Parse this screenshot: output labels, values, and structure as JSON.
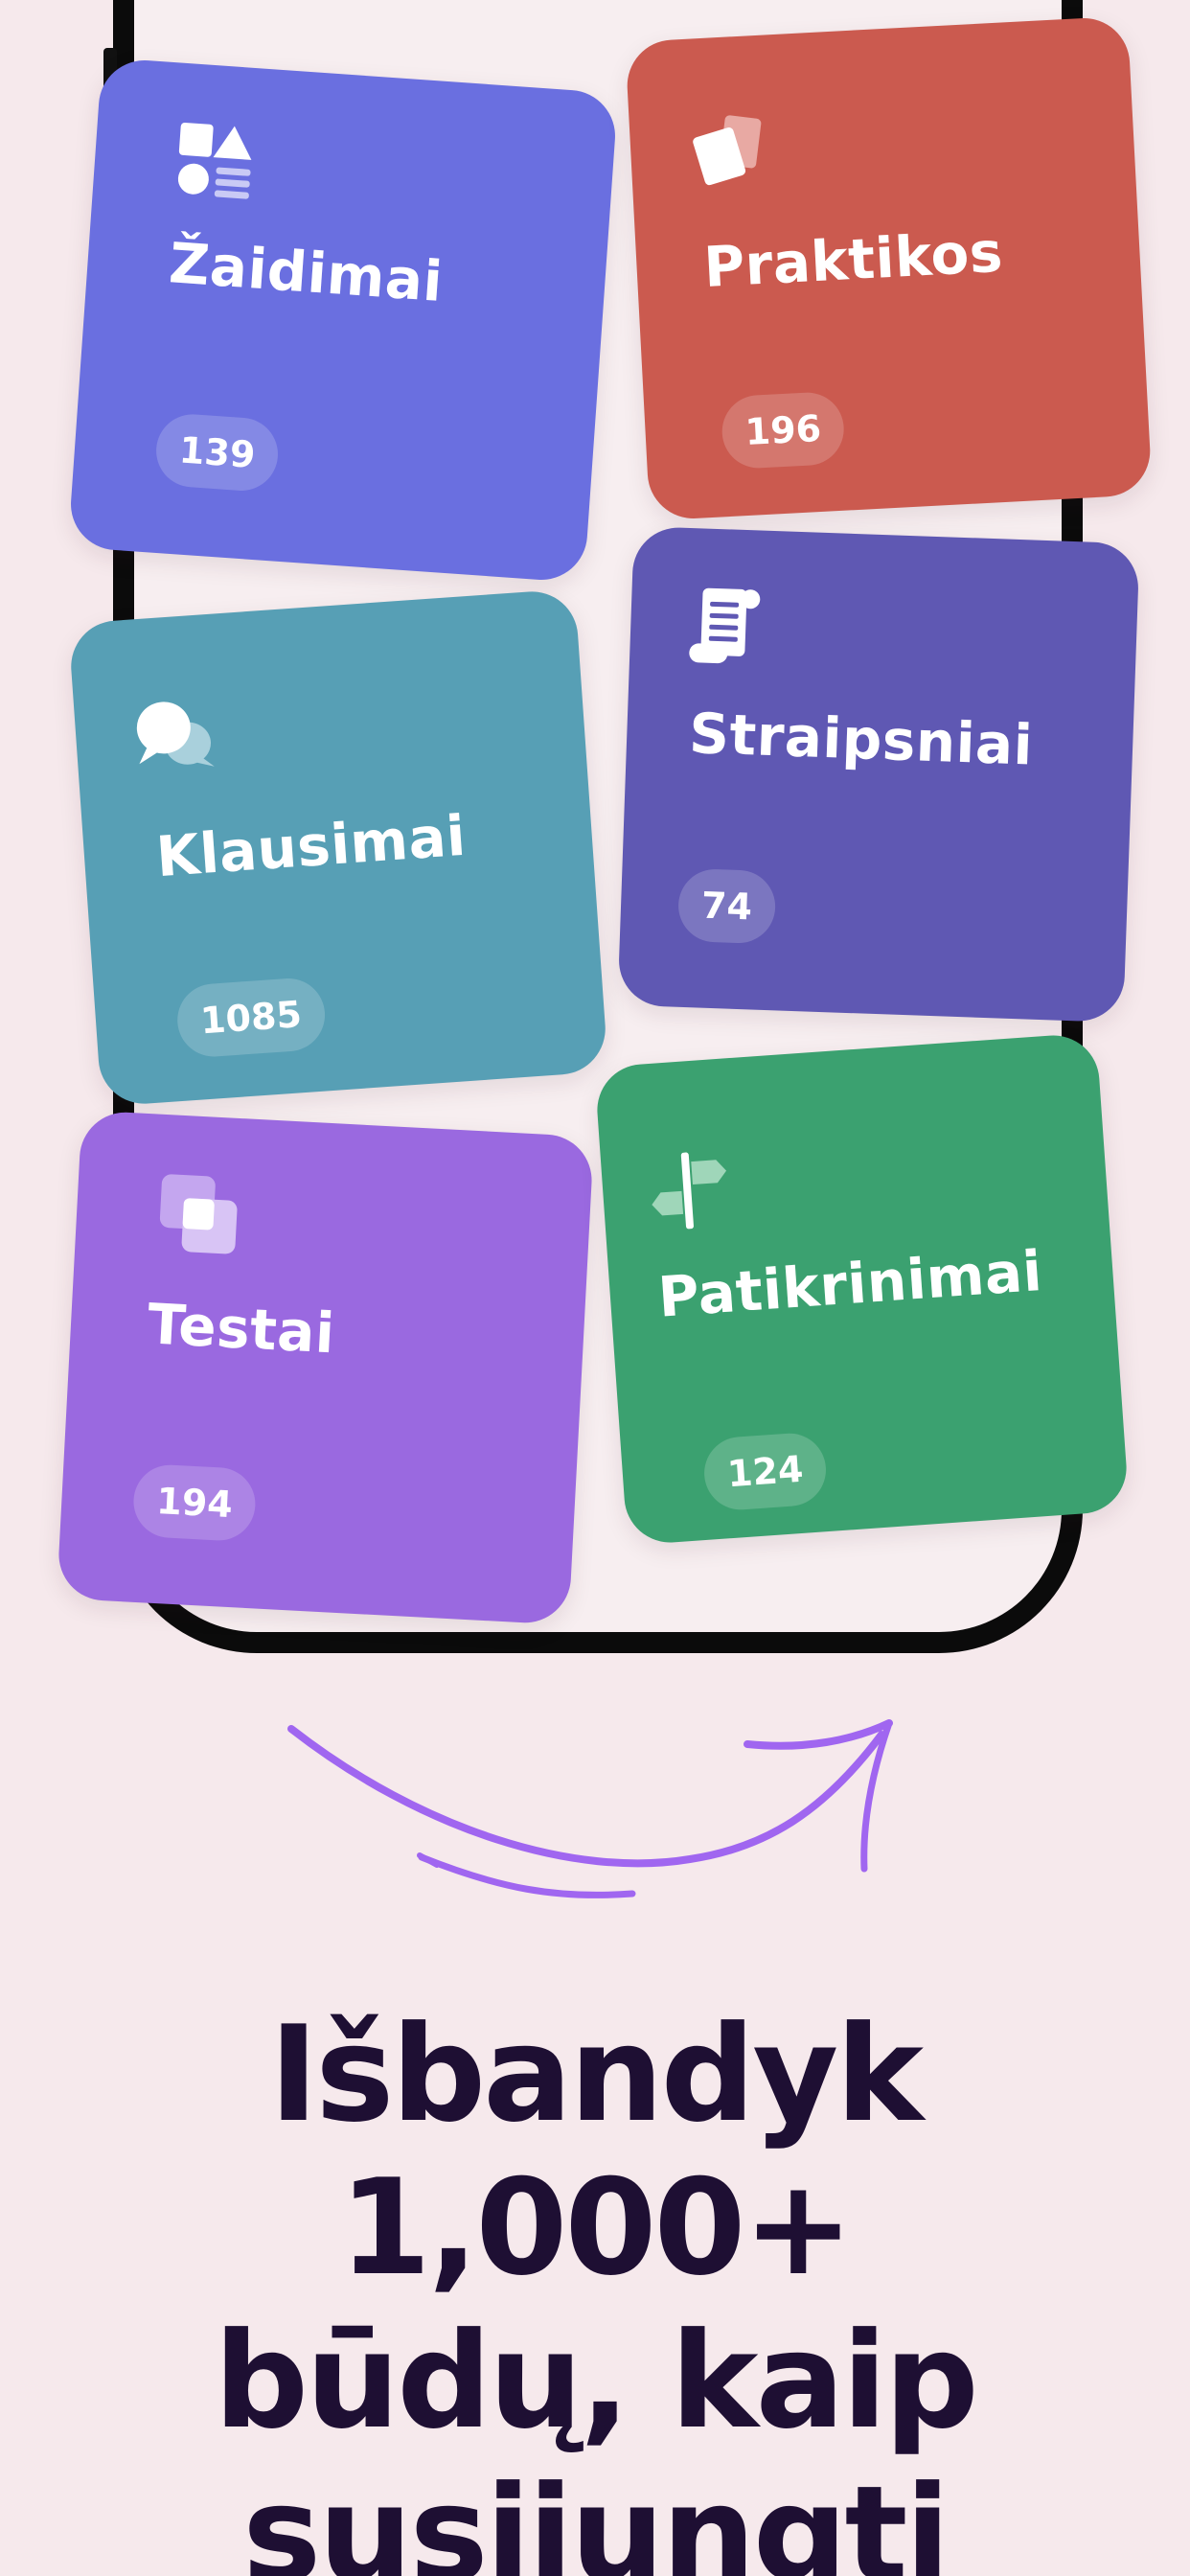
{
  "cards": [
    {
      "title": "Žaidimai",
      "count": "139",
      "icon": "shapes-icon",
      "color": "#6a6fe0"
    },
    {
      "title": "Praktikos",
      "count": "196",
      "icon": "cards-icon",
      "color": "#cb5a4f"
    },
    {
      "title": "Klausimai",
      "count": "1085",
      "icon": "chat-bubbles-icon",
      "color": "#579fb5"
    },
    {
      "title": "Straipsniai",
      "count": "74",
      "icon": "scroll-icon",
      "color": "#5f58b3"
    },
    {
      "title": "Testai",
      "count": "194",
      "icon": "squares-icon",
      "color": "#9a69e0"
    },
    {
      "title": "Patikrinimai",
      "count": "124",
      "icon": "signpost-icon",
      "color": "#3ba170"
    }
  ],
  "headline": {
    "line1": "Išbandyk 1,000+",
    "line2": "būdų, kaip",
    "line3": "susijungti"
  },
  "colors": {
    "background": "#f6e9ec",
    "headline": "#1e0f33",
    "arrow": "#a066f0"
  }
}
